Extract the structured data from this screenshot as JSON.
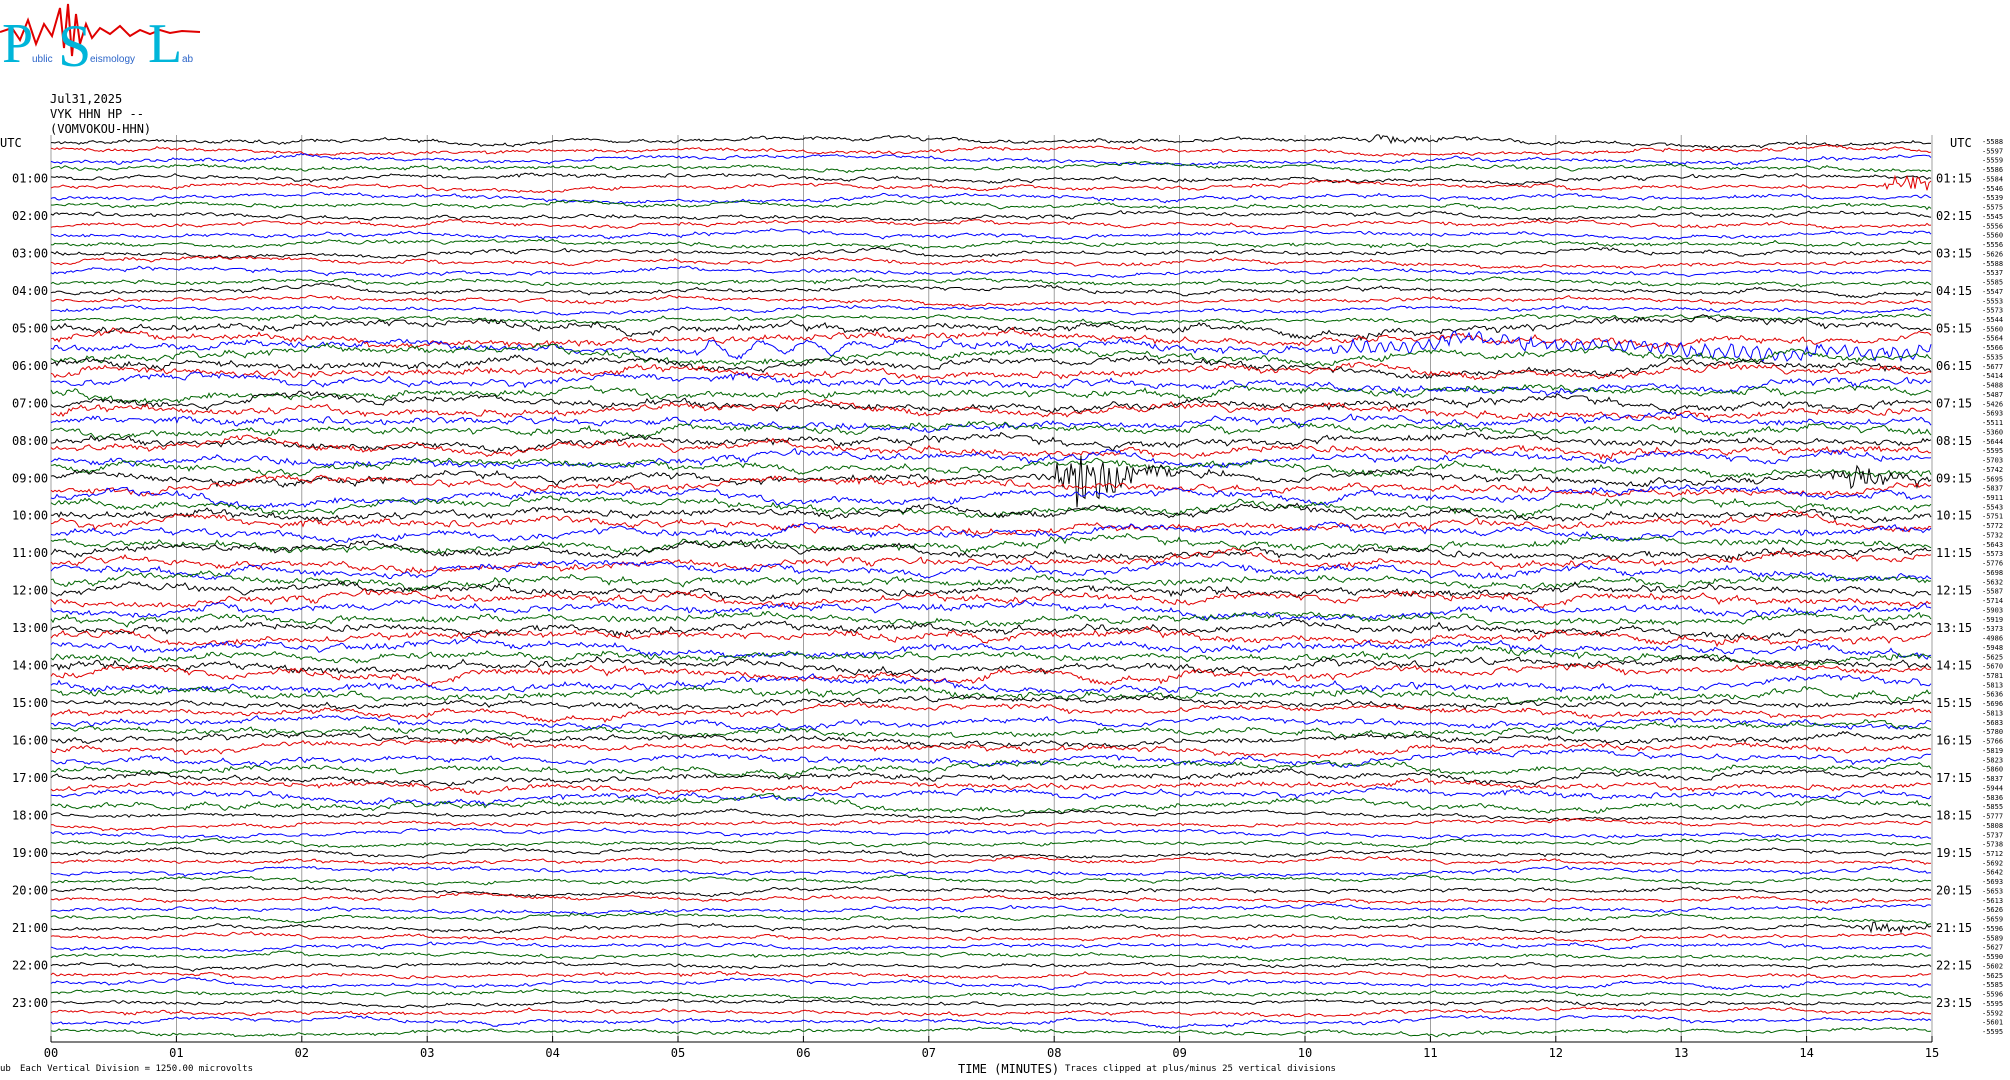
{
  "logo": {
    "letters": [
      "P",
      "S",
      "L"
    ],
    "fragments": [
      "ublic",
      "eismology",
      "ab"
    ]
  },
  "header": {
    "date": "Jul31,2025",
    "station": "VYK HHN HP --",
    "location": "(VOMVOKOU-HHN)"
  },
  "utc_label": "UTC",
  "footer": {
    "scale_note": "Each Vertical Division = 1250.00 microvolts",
    "x_axis_title": "TIME (MINUTES)",
    "clip_note": "Traces clipped at plus/minus 25 vertical divisions",
    "corner_mark": "ub"
  },
  "colors": {
    "trace_cycle": [
      "#000000",
      "#e00000",
      "#0000ff",
      "#006400"
    ],
    "grid": "#888888"
  },
  "chart_data": {
    "type": "line",
    "subtype": "helicorder",
    "x_ticks": [
      "00",
      "01",
      "02",
      "03",
      "04",
      "05",
      "06",
      "07",
      "08",
      "09",
      "10",
      "11",
      "12",
      "13",
      "14",
      "15"
    ],
    "xlim": [
      0,
      15
    ],
    "lines_per_hour": 4,
    "row_count": 96,
    "left_hour_labels": [
      "01:00",
      "02:00",
      "03:00",
      "04:00",
      "05:00",
      "06:00",
      "07:00",
      "08:00",
      "09:00",
      "10:00",
      "11:00",
      "12:00",
      "13:00",
      "14:00",
      "15:00",
      "16:00",
      "17:00",
      "18:00",
      "19:00",
      "20:00",
      "21:00",
      "22:00",
      "23:00"
    ],
    "right_hour_labels": [
      "01:15",
      "02:15",
      "03:15",
      "04:15",
      "05:15",
      "06:15",
      "07:15",
      "08:15",
      "09:15",
      "10:15",
      "11:15",
      "12:15",
      "13:15",
      "14:15",
      "15:15",
      "16:15",
      "17:15",
      "18:15",
      "19:15",
      "20:15",
      "21:15",
      "22:15",
      "23:15"
    ],
    "right_offsets": [
      "-5588",
      "-5597",
      "-5559",
      "-5586",
      "-5584",
      "-5546",
      "-5539",
      "-5575",
      "-5545",
      "-5556",
      "-5560",
      "-5556",
      "-5626",
      "-5588",
      "-5537",
      "-5585",
      "-5547",
      "-5553",
      "-5573",
      "-5544",
      "-5560",
      "-5564",
      "-5566",
      "-5535",
      "-5677",
      "-5414",
      "-5488",
      "-5487",
      "-5426",
      "-5693",
      "-5511",
      "-5360",
      "-5644",
      "-5595",
      "-5703",
      "-5742",
      "-5695",
      "-5837",
      "-5911",
      "-5543",
      "-5751",
      "-5772",
      "-5732",
      "-5643",
      "-5573",
      "-5776",
      "-5698",
      "-5632",
      "-5587",
      "-5714",
      "-5903",
      "-5919",
      "-5373",
      "-4986",
      "-5948",
      "-5625",
      "-5670",
      "-5781",
      "-5813",
      "-5636",
      "-5696",
      "-5813",
      "-5683",
      "-5780",
      "-5766",
      "-5819",
      "-5823",
      "-5860",
      "-5837",
      "-5944",
      "-5836",
      "-5855",
      "-5777",
      "-5808",
      "-5737",
      "-5738",
      "-5712",
      "-5692",
      "-5642",
      "-5693",
      "-5653",
      "-5613",
      "-5626",
      "-5659",
      "-5596",
      "-5589",
      "-5627",
      "-5590",
      "-5602",
      "-5625",
      "-5585",
      "-5596",
      "-5595",
      "-5592",
      "-5601",
      "-5595"
    ],
    "events": [
      {
        "row": 0,
        "minute": 10.5,
        "amplitude": "small",
        "note": "wavelet"
      },
      {
        "row": 5,
        "minute": 14.7,
        "amplitude": "medium"
      },
      {
        "row": 22,
        "minute": 5.3,
        "amplitude": "medium",
        "note": "long period oscillation"
      },
      {
        "row": 22,
        "minute": 10.2,
        "amplitude": "medium",
        "note": "sustained wavetrain to 15"
      },
      {
        "row": 36,
        "minute": 8.1,
        "amplitude": "large",
        "note": "earthquake"
      },
      {
        "row": 36,
        "minute": 14.3,
        "amplitude": "medium"
      },
      {
        "row": 84,
        "minute": 14.5,
        "amplitude": "small"
      }
    ]
  }
}
